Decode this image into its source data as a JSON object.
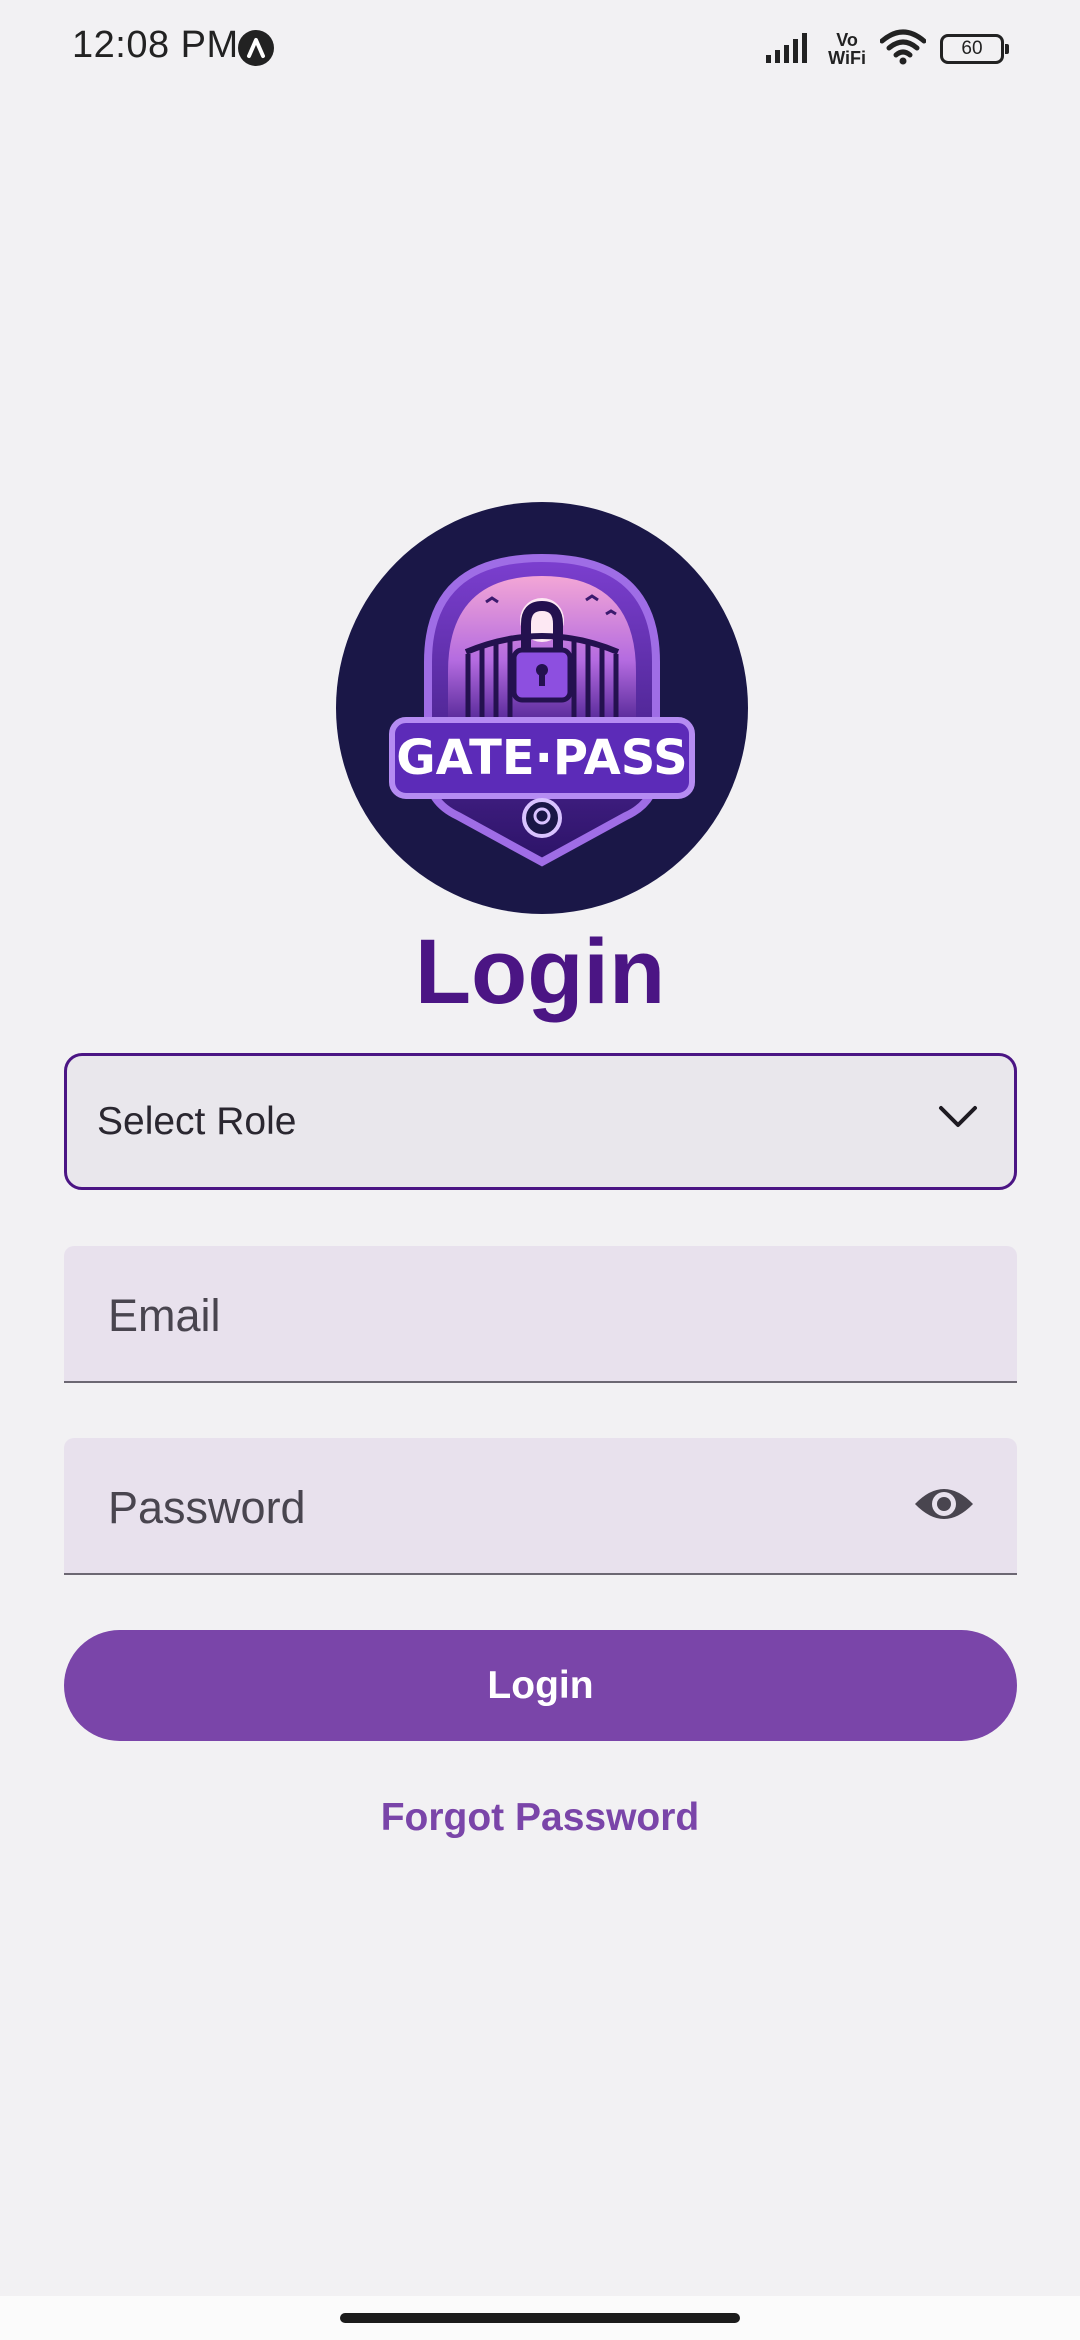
{
  "status_bar": {
    "time": "12:08 PM",
    "network_label": "Vo WiFi",
    "network_line1": "Vo",
    "network_line2": "WiFi",
    "battery_level": "60",
    "icons": [
      "notification-a-icon",
      "signal-icon",
      "wifi-icon",
      "battery-icon"
    ]
  },
  "logo": {
    "alt": "GATE·PASS",
    "text": "GATE·PASS"
  },
  "page": {
    "title": "Login"
  },
  "form": {
    "role_select": {
      "selected": "Select Role",
      "icon": "chevron-down-icon"
    },
    "email": {
      "placeholder": "Email",
      "value": ""
    },
    "password": {
      "placeholder": "Password",
      "value": "",
      "icon": "eye-icon"
    },
    "submit_label": "Login",
    "forgot_label": "Forgot Password"
  },
  "colors": {
    "primary": "#7a45a9",
    "title": "#4b1584",
    "background": "#f2f1f3",
    "field_background": "#e8e1ed",
    "logo_background": "#1a1747"
  }
}
